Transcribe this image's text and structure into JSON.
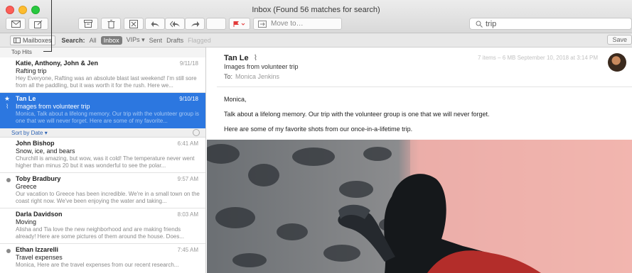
{
  "window": {
    "title": "Inbox (Found 56 matches for search)"
  },
  "toolbar": {
    "move_to_label": "Move to…"
  },
  "search": {
    "query": "trip"
  },
  "favorites": {
    "mailboxes_label": "Mailboxes",
    "search_label": "Search:",
    "scopes": [
      "All",
      "Inbox",
      "VIPs ▾",
      "Sent",
      "Drafts",
      "Flagged"
    ],
    "save_label": "Save"
  },
  "callout": {
    "label": "Top Hits"
  },
  "top_hits": [
    {
      "from": "Katie, Anthony, John & Jen",
      "date": "9/11/18",
      "subject": "Rafting trip",
      "preview": "Hey Everyone, Rafting was an absolute blast last weekend! I'm still sore from all the paddling, but it was worth it for the rush. Here we..."
    },
    {
      "from": "Tan Le",
      "date": "9/10/18",
      "subject": "Images from volunteer trip",
      "preview": "Monica, Talk about a lifelong memory. Our trip with the volunteer group is one that we will never forget. Here are some of my favorite..."
    }
  ],
  "sort": {
    "label": "Sort by Date ▾"
  },
  "messages": [
    {
      "from": "John Bishop",
      "time": "6:41 AM",
      "subject": "Snow, ice, and bears",
      "preview": "Churchill is amazing, but wow, was it cold! The temperature never went higher than minus 20 but it was wonderful to see the polar..."
    },
    {
      "from": "Toby Bradbury",
      "time": "9:57 AM",
      "subject": "Greece",
      "preview": "Our vacation to Greece has been incredible. We're in a small town on the coast right now. We've been enjoying the water and taking..."
    },
    {
      "from": "Darla Davidson",
      "time": "8:03 AM",
      "subject": "Moving",
      "preview": "Alisha and Tia love the new neighborhood and are making friends already! Here are some pictures of them around the house. Does..."
    },
    {
      "from": "Ethan Izzarelli",
      "time": "7:45 AM",
      "subject": "Travel expenses",
      "preview": "Monica, Here are the travel expenses from our recent research..."
    }
  ],
  "viewer": {
    "from": "Tan Le",
    "subject": "Images from volunteer trip",
    "to_label": "To:",
    "to": "Monica Jenkins",
    "meta": "7 items – 6 MB     September 10, 2018 at 3:14 PM",
    "greeting": "Monica,",
    "line1": "Talk about a lifelong memory. Our trip with the volunteer group is one that we will never forget.",
    "line2": "Here are some of my favorite shots from our once-in-a-lifetime trip."
  },
  "colors": {
    "selection": "#2c77e0",
    "flag": "#e33b3b"
  }
}
